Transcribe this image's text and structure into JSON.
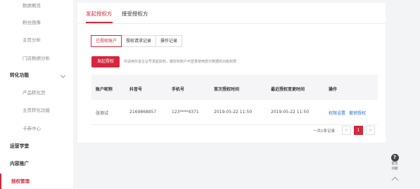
{
  "sidebar": {
    "items": [
      {
        "label": "数据概览",
        "kind": "sub"
      },
      {
        "label": "粉丝画像",
        "kind": "sub"
      },
      {
        "label": "主页分析",
        "kind": "sub"
      },
      {
        "label": "门店数据分析",
        "kind": "sub"
      },
      {
        "label": "转化功能",
        "kind": "group"
      },
      {
        "label": "产品转化页",
        "kind": "sub"
      },
      {
        "label": "主页转化功能",
        "kind": "sub"
      },
      {
        "label": "卡券中心",
        "kind": "sub"
      },
      {
        "label": "运营学堂",
        "kind": "group"
      },
      {
        "label": "内容推广",
        "kind": "group"
      },
      {
        "label": "授权管理",
        "kind": "active"
      }
    ]
  },
  "top_tabs": [
    "发起授权方",
    "接受授权方"
  ],
  "sub_tabs": [
    "已授权账户",
    "授权请求记录",
    "操作记录"
  ],
  "primary_button": "发起授权",
  "hint": "仅适用抖音企业号发起授权，被授权账户可登录使用部分数据的功能权限",
  "table": {
    "headers": [
      "账户昵称",
      "抖音号",
      "手机号",
      "首次授权时间",
      "最近授权变更时间",
      "操作"
    ],
    "rows": [
      {
        "nickname": "张测试",
        "douyin_id": "2169868857",
        "phone": "123****4371",
        "first_time": "2019-05-22 11:50",
        "last_time": "2019-05-22 11:50",
        "action1": "权限设置",
        "action2": "撤销授权"
      }
    ]
  },
  "pager": {
    "total": "一共1条记录",
    "prev": "<",
    "current": "1",
    "next": ">"
  },
  "help": {
    "icon": "?",
    "label_line1": "常见",
    "label_line2": "问题"
  },
  "colors": {
    "accent": "#d7263d",
    "link": "#2f6fde"
  }
}
